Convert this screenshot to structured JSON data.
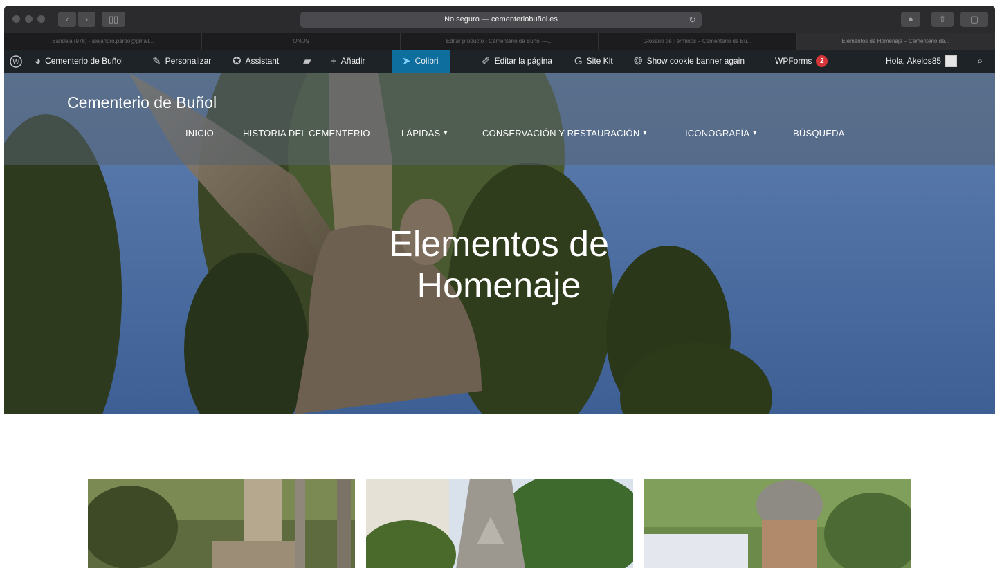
{
  "browser": {
    "address": "No seguro — cementeriobuñol.es",
    "tabs": [
      "Bandeja (978) - alejandro.pardo@gmail...",
      "ONOS",
      "Editar producto ‹ Cementerio de Buñol —...",
      "Glosario de Términos – Cementerio de Bu...",
      "Elementos de Homenaje – Cementerio de..."
    ],
    "active_tab_index": 4
  },
  "adminbar": {
    "site_name": "Cementerio de Buñol",
    "customize": "Personalizar",
    "assistant": "Assistant",
    "add_new": "Añadir",
    "colibri": "Colibri",
    "edit_page": "Editar la página",
    "site_kit": "Site Kit",
    "cookie_banner": "Show cookie banner again",
    "wpforms": "WPForms",
    "wpforms_count": "2",
    "greeting": "Hola, Akelos85"
  },
  "site": {
    "title": "Cementerio de Buñol",
    "nav": [
      {
        "label": "INICIO",
        "has_submenu": false
      },
      {
        "label": "HISTORIA DEL CEMENTERIO",
        "has_submenu": false
      },
      {
        "label": "LÁPIDAS",
        "has_submenu": true
      },
      {
        "label": "CONSERVACIÓN Y RESTAURACIÓN",
        "has_submenu": true
      },
      {
        "label": "ICONOGRAFÍA",
        "has_submenu": true
      },
      {
        "label": "BÚSQUEDA",
        "has_submenu": false
      }
    ]
  },
  "hero": {
    "title_line1": "Elementos de",
    "title_line2": "Homenaje"
  },
  "colors": {
    "adminbar_bg": "#1d2327",
    "colibri_bg": "#0e6e9e",
    "badge": "#d63638"
  },
  "icons": {
    "chevron": "▾"
  }
}
